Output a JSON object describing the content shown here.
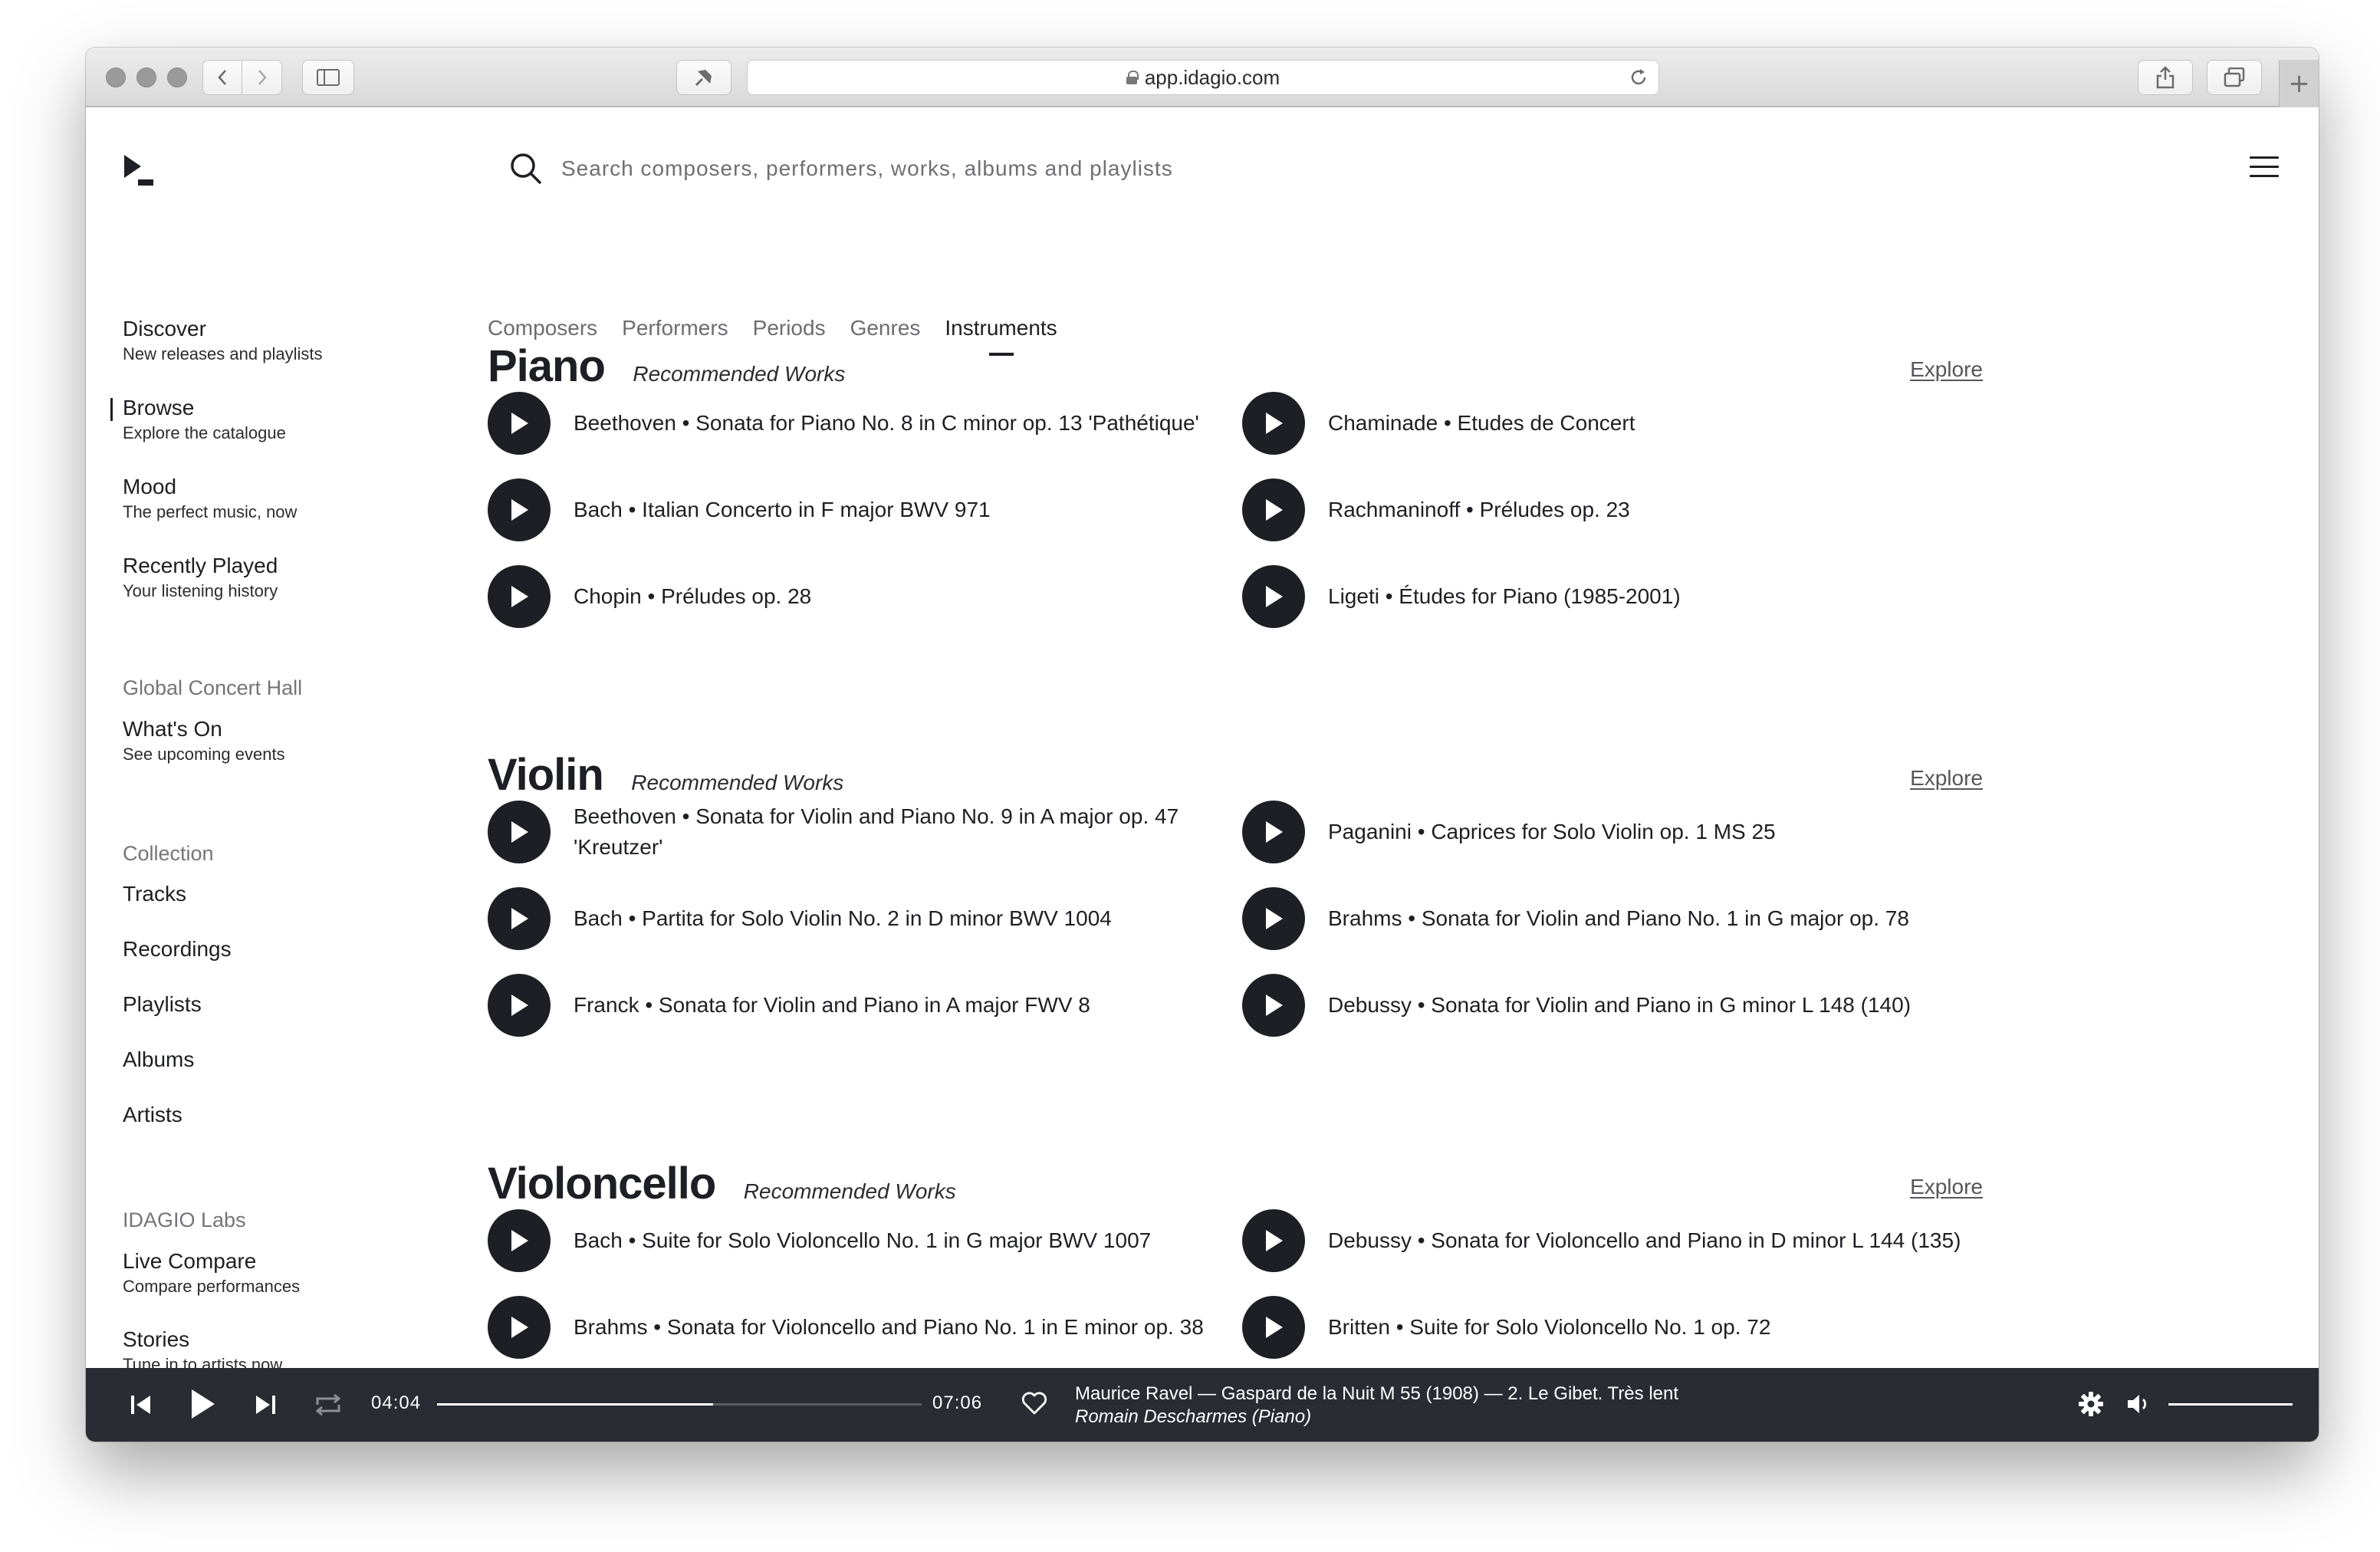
{
  "browser": {
    "url": "app.idagio.com",
    "plus": "+"
  },
  "search": {
    "placeholder": "Search composers, performers, works, albums and playlists"
  },
  "sidebar": {
    "nav": [
      {
        "title": "Discover",
        "sub": "New releases and playlists"
      },
      {
        "title": "Browse",
        "sub": "Explore the catalogue"
      },
      {
        "title": "Mood",
        "sub": "The perfect music, now"
      },
      {
        "title": "Recently Played",
        "sub": "Your listening history"
      }
    ],
    "concert_hall": {
      "heading": "Global Concert Hall",
      "item": {
        "title": "What's On",
        "sub": "See upcoming events"
      }
    },
    "collection": {
      "heading": "Collection",
      "items": [
        "Tracks",
        "Recordings",
        "Playlists",
        "Albums",
        "Artists"
      ]
    },
    "labs": {
      "heading": "IDAGIO Labs",
      "items": [
        {
          "title": "Live Compare",
          "sub": "Compare performances"
        },
        {
          "title": "Stories",
          "sub": "Tune in to artists now"
        }
      ]
    }
  },
  "tabs": [
    "Composers",
    "Performers",
    "Periods",
    "Genres",
    "Instruments"
  ],
  "active_tab": "Instruments",
  "sections": [
    {
      "title": "Piano",
      "subtitle": "Recommended Works",
      "explore": "Explore",
      "works": [
        "Beethoven • Sonata for Piano No. 8 in C minor op. 13 'Pathétique'",
        "Chaminade • Etudes de Concert",
        "Bach • Italian Concerto in F major BWV 971",
        "Rachmaninoff • Préludes op. 23",
        "Chopin • Préludes op. 28",
        "Ligeti • Études for Piano (1985-2001)"
      ]
    },
    {
      "title": "Violin",
      "subtitle": "Recommended Works",
      "explore": "Explore",
      "works": [
        "Beethoven • Sonata for Violin and Piano No. 9 in A major op. 47 'Kreutzer'",
        "Paganini • Caprices for Solo Violin op. 1 MS 25",
        "Bach • Partita for Solo Violin No. 2 in D minor BWV 1004",
        "Brahms • Sonata for Violin and Piano No. 1 in G major op. 78",
        "Franck • Sonata for Violin and Piano in A major FWV 8",
        "Debussy • Sonata for Violin and Piano in G minor L 148 (140)"
      ]
    },
    {
      "title": "Violoncello",
      "subtitle": "Recommended Works",
      "explore": "Explore",
      "works": [
        "Bach • Suite for Solo Violoncello No. 1 in G major BWV 1007",
        "Debussy • Sonata for Violoncello and Piano in D minor L 144 (135)",
        "Brahms • Sonata for Violoncello and Piano No. 1 in E minor op. 38",
        "Britten • Suite for Solo Violoncello No. 1 op. 72"
      ]
    }
  ],
  "player": {
    "elapsed": "04:04",
    "duration": "07:06",
    "progress_fraction": 0.57,
    "volume_fraction": 1.0,
    "track": "Maurice Ravel — Gaspard de la Nuit M 55 (1908) — 2. Le Gibet. Très lent",
    "artist": "Romain Descharmes (Piano)"
  },
  "colors": {
    "text": "#1e1f24",
    "muted": "#6c6d72",
    "player_bg": "#2a2c33",
    "play_button": "#1e1f24"
  }
}
